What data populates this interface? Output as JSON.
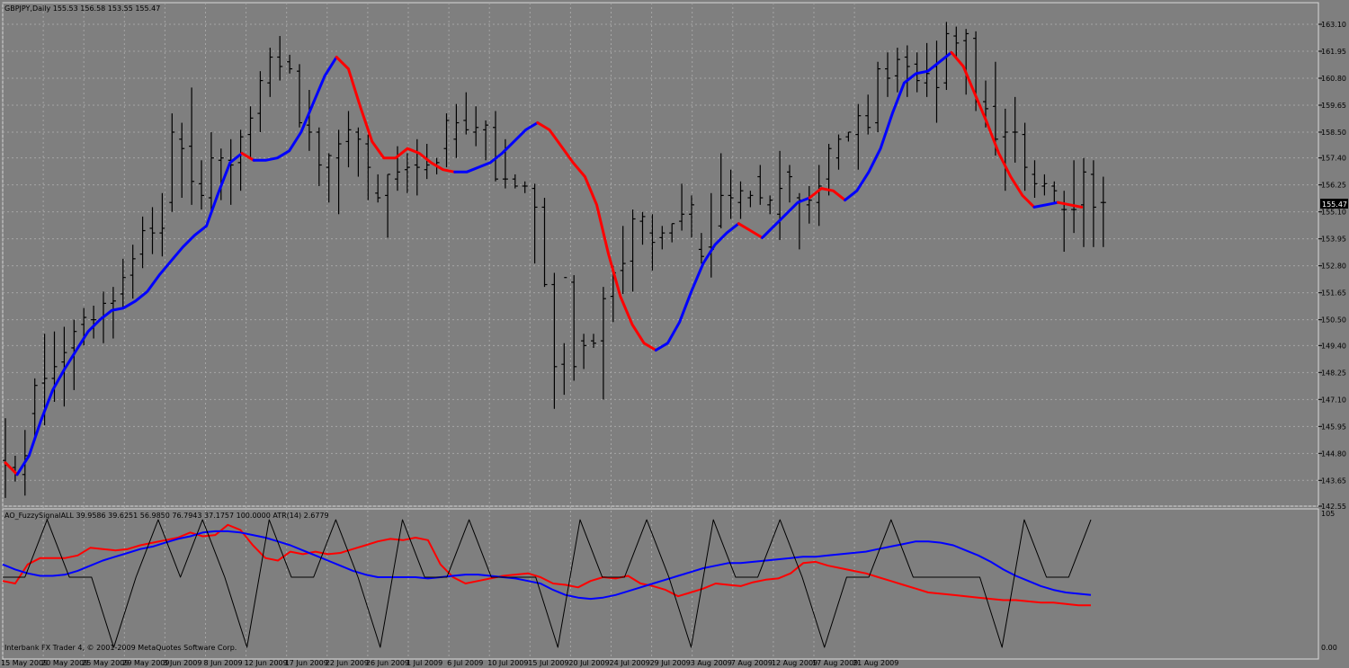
{
  "chart_header": "GBPJPY,Daily  155.53 156.58 153.55 155.47",
  "indicator_header": "AO_FuzzySignalALL 39.9586 39.6251 56.9850 76.7943 37.1757 100.0000  ATR(14) 2.6779",
  "copyright": "Interbank FX Trader 4, © 2001-2009 MetaQuotes Software Corp.",
  "current_price_label": "155.47",
  "colors": {
    "background": "#7f7f7f",
    "bars": "#000000",
    "up": "#0000ff",
    "down": "#ff0000",
    "grid": "#a6a6a6",
    "fuzzy": "#000000"
  },
  "chart_data": [
    {
      "type": "ohlc",
      "ylim": [
        142.55,
        163.1
      ],
      "y_ticks": [
        "163.10",
        "161.95",
        "160.80",
        "159.65",
        "158.50",
        "157.40",
        "156.25",
        "155.10",
        "153.95",
        "152.80",
        "151.65",
        "150.50",
        "149.40",
        "148.25",
        "147.10",
        "145.95",
        "144.80",
        "143.65",
        "142.55"
      ],
      "x_tick_labels": [
        "15 May 2009",
        "20 May 2009",
        "25 May 2009",
        "29 May 2009",
        "3 Jun 2009",
        "8 Jun 2009",
        "12 Jun 2009",
        "17 Jun 2009",
        "22 Jun 2009",
        "26 Jun 2009",
        "1 Jul 2009",
        "6 Jul 2009",
        "10 Jul 2009",
        "15 Jul 2009",
        "20 Jul 2009",
        "24 Jul 2009",
        "29 Jul 2009",
        "3 Aug 2009",
        "7 Aug 2009",
        "12 Aug 2009",
        "17 Aug 2009",
        "21 Aug 2009"
      ],
      "ohlc": [
        [
          144.5,
          146.3,
          142.9,
          144.3
        ],
        [
          144.2,
          144.7,
          143.6,
          143.9
        ],
        [
          143.9,
          145.8,
          143.0,
          144.7
        ],
        [
          146.5,
          148.0,
          145.5,
          147.7
        ],
        [
          147.8,
          149.9,
          146.0,
          148.0
        ],
        [
          148.0,
          150.0,
          147.0,
          148.5
        ],
        [
          148.7,
          150.2,
          146.8,
          149.1
        ],
        [
          149.3,
          150.5,
          147.5,
          150.0
        ],
        [
          150.3,
          151.0,
          149.4,
          150.6
        ],
        [
          150.5,
          151.1,
          149.7,
          150.5
        ],
        [
          150.6,
          151.7,
          149.5,
          151.2
        ],
        [
          151.2,
          151.9,
          149.7,
          151.3
        ],
        [
          151.6,
          153.1,
          151.0,
          152.3
        ],
        [
          152.4,
          153.7,
          151.4,
          153.1
        ],
        [
          153.3,
          154.9,
          152.7,
          154.3
        ],
        [
          154.4,
          155.3,
          153.3,
          154.2
        ],
        [
          154.2,
          155.9,
          153.2,
          154.4
        ],
        [
          155.5,
          159.3,
          155.1,
          158.5
        ],
        [
          158.2,
          158.9,
          155.7,
          157.8
        ],
        [
          157.9,
          160.4,
          155.4,
          156.4
        ],
        [
          156.3,
          157.3,
          155.2,
          155.8
        ],
        [
          155.7,
          158.5,
          155.0,
          157.4
        ],
        [
          157.3,
          157.8,
          155.6,
          157.4
        ],
        [
          157.3,
          158.2,
          155.4,
          157.1
        ],
        [
          157.2,
          158.6,
          156.0,
          158.3
        ],
        [
          158.4,
          159.6,
          157.4,
          159.1
        ],
        [
          159.3,
          161.1,
          158.5,
          160.7
        ],
        [
          160.6,
          162.1,
          160.0,
          161.7
        ],
        [
          161.7,
          162.6,
          160.7,
          161.3
        ],
        [
          161.5,
          161.8,
          161.0,
          161.2
        ],
        [
          161.1,
          161.4,
          158.7,
          158.9
        ],
        [
          158.8,
          160.3,
          157.7,
          158.5
        ],
        [
          158.5,
          158.7,
          156.2,
          157.1
        ],
        [
          157.0,
          157.6,
          155.5,
          157.5
        ],
        [
          157.4,
          158.6,
          155.0,
          158.0
        ],
        [
          158.1,
          159.4,
          157.0,
          158.6
        ],
        [
          158.5,
          158.7,
          156.6,
          158.2
        ],
        [
          158.0,
          158.4,
          155.6,
          157.0
        ],
        [
          155.9,
          156.7,
          155.5,
          155.7
        ],
        [
          155.8,
          156.7,
          154.0,
          156.7
        ],
        [
          156.5,
          157.9,
          156.0,
          156.8
        ],
        [
          156.9,
          157.6,
          155.9,
          157.0
        ],
        [
          157.1,
          158.2,
          155.8,
          157.0
        ],
        [
          156.9,
          158.0,
          156.5,
          157.1
        ],
        [
          157.1,
          157.4,
          156.7,
          157.2
        ],
        [
          157.8,
          159.3,
          157.0,
          159.0
        ],
        [
          158.2,
          159.7,
          157.4,
          158.9
        ],
        [
          159.0,
          160.2,
          158.4,
          158.6
        ],
        [
          158.5,
          159.6,
          157.9,
          158.7
        ],
        [
          158.6,
          159.0,
          157.3,
          158.8
        ],
        [
          158.7,
          159.4,
          156.4,
          156.5
        ],
        [
          156.5,
          158.2,
          156.1,
          156.5
        ],
        [
          156.5,
          156.7,
          156.1,
          156.2
        ],
        [
          156.2,
          156.4,
          155.9,
          156.2
        ],
        [
          156.1,
          156.3,
          152.9,
          155.3
        ],
        [
          155.3,
          155.7,
          151.9,
          152.0
        ],
        [
          152.0,
          152.5,
          146.7,
          148.5
        ],
        [
          148.6,
          149.5,
          147.3,
          152.3
        ],
        [
          152.1,
          152.4,
          147.9,
          148.5
        ],
        [
          149.6,
          149.9,
          148.4,
          149.4
        ],
        [
          149.6,
          149.9,
          149.3,
          149.5
        ],
        [
          149.6,
          151.9,
          147.1,
          151.4
        ],
        [
          151.5,
          152.8,
          150.4,
          152.5
        ],
        [
          152.6,
          154.5,
          151.6,
          152.9
        ],
        [
          153.0,
          155.2,
          151.7,
          154.8
        ],
        [
          154.7,
          155.1,
          153.7,
          154.9
        ],
        [
          154.2,
          155.0,
          152.6,
          153.8
        ],
        [
          154.0,
          154.5,
          153.5,
          154.2
        ],
        [
          154.2,
          154.6,
          153.8,
          154.6
        ],
        [
          154.7,
          156.3,
          154.3,
          155.0
        ],
        [
          155.0,
          155.8,
          154.0,
          155.4
        ],
        [
          153.5,
          154.2,
          152.9,
          153.2
        ],
        [
          153.6,
          155.9,
          152.3,
          153.5
        ],
        [
          154.5,
          157.6,
          154.4,
          155.8
        ],
        [
          155.8,
          156.9,
          154.8,
          155.7
        ],
        [
          155.5,
          156.4,
          154.8,
          156.0
        ],
        [
          155.7,
          156.0,
          155.3,
          155.8
        ],
        [
          156.6,
          157.1,
          155.4,
          155.7
        ],
        [
          155.4,
          155.8,
          155.0,
          155.6
        ],
        [
          155.0,
          157.7,
          153.9,
          156.1
        ],
        [
          156.8,
          157.1,
          155.5,
          156.6
        ],
        [
          155.7,
          155.9,
          153.5,
          155.6
        ],
        [
          155.4,
          156.2,
          154.6,
          155.6
        ],
        [
          155.5,
          157.1,
          154.5,
          156.2
        ],
        [
          156.5,
          158.0,
          155.8,
          157.8
        ],
        [
          157.4,
          158.4,
          156.9,
          158.2
        ],
        [
          158.3,
          158.5,
          158.1,
          158.5
        ],
        [
          158.4,
          159.7,
          156.9,
          159.2
        ],
        [
          159.2,
          160.1,
          158.4,
          158.7
        ],
        [
          158.9,
          161.5,
          158.5,
          161.2
        ],
        [
          161.2,
          161.9,
          160.0,
          160.8
        ],
        [
          160.9,
          162.1,
          160.2,
          161.6
        ],
        [
          161.7,
          162.2,
          160.0,
          161.3
        ],
        [
          161.4,
          161.9,
          160.2,
          160.7
        ],
        [
          160.6,
          162.3,
          160.0,
          161.0
        ],
        [
          161.3,
          162.4,
          158.9,
          160.4
        ],
        [
          160.6,
          163.2,
          160.3,
          162.7
        ],
        [
          162.6,
          163.0,
          161.7,
          162.3
        ],
        [
          162.4,
          162.9,
          160.1,
          162.7
        ],
        [
          162.5,
          162.8,
          159.4,
          159.8
        ],
        [
          159.8,
          160.7,
          158.7,
          159.5
        ],
        [
          159.6,
          161.5,
          157.5,
          158.2
        ],
        [
          158.3,
          159.5,
          156.0,
          158.5
        ],
        [
          158.5,
          160.0,
          157.2,
          158.5
        ],
        [
          158.4,
          158.9,
          156.0,
          157.0
        ],
        [
          156.7,
          157.3,
          155.7,
          156.3
        ],
        [
          156.2,
          156.7,
          155.8,
          156.3
        ],
        [
          156.2,
          156.4,
          155.5,
          156.0
        ],
        [
          155.2,
          156.0,
          153.4,
          155.2
        ],
        [
          155.2,
          157.3,
          154.2,
          155.2
        ],
        [
          155.4,
          157.4,
          153.6,
          156.8
        ],
        [
          156.7,
          157.3,
          153.6,
          155.3
        ],
        [
          155.5,
          156.6,
          153.6,
          155.5
        ]
      ],
      "smoothed_line": [
        {
          "start": 0,
          "color": "red",
          "values": [
            144.4,
            143.9
          ]
        },
        {
          "start": 1,
          "color": "blue",
          "values": [
            143.9,
            144.7,
            146.2,
            147.5,
            148.4,
            149.2,
            150.0,
            150.5,
            150.9,
            151.0,
            151.3,
            151.7,
            152.4,
            153.0,
            153.6,
            154.1,
            154.5,
            155.9,
            157.2,
            157.6
          ]
        },
        {
          "start": 20,
          "color": "red",
          "values": [
            157.6,
            157.3
          ]
        },
        {
          "start": 21,
          "color": "blue",
          "values": [
            157.3,
            157.3,
            157.4,
            157.7,
            158.5,
            159.7,
            160.9,
            161.7
          ]
        },
        {
          "start": 28,
          "color": "red",
          "values": [
            161.7,
            161.2,
            159.6,
            158.1,
            157.4,
            157.4,
            157.8,
            157.6,
            157.2,
            156.9,
            156.8
          ]
        },
        {
          "start": 38,
          "color": "blue",
          "values": [
            156.8,
            156.8,
            157.0,
            157.2,
            157.6,
            158.1,
            158.6,
            158.9
          ]
        },
        {
          "start": 45,
          "color": "red",
          "values": [
            158.9,
            158.6,
            157.9,
            157.2,
            156.6,
            155.4,
            153.3,
            151.5,
            150.3,
            149.5,
            149.2
          ]
        },
        {
          "start": 55,
          "color": "blue",
          "values": [
            149.2,
            149.5,
            150.4,
            151.7,
            152.9,
            153.7,
            154.2,
            154.6
          ]
        },
        {
          "start": 62,
          "color": "red",
          "values": [
            154.6,
            154.3,
            154.0
          ]
        },
        {
          "start": 64,
          "color": "blue",
          "values": [
            154.0,
            154.5,
            155.0,
            155.5,
            155.7
          ]
        },
        {
          "start": 68,
          "color": "red",
          "values": [
            155.7,
            156.1,
            156.0,
            155.6
          ]
        },
        {
          "start": 71,
          "color": "blue",
          "values": [
            155.6,
            156.0,
            156.8,
            157.8,
            159.3,
            160.6,
            161.0,
            161.1,
            161.5,
            161.9
          ]
        },
        {
          "start": 80,
          "color": "red",
          "values": [
            161.9,
            161.3,
            160.1,
            158.9,
            157.6,
            156.6,
            155.8,
            155.3
          ]
        },
        {
          "start": 87,
          "color": "blue",
          "values": [
            155.3,
            155.4,
            155.5
          ]
        },
        {
          "start": 89,
          "color": "red",
          "values": [
            155.5,
            155.4,
            155.3
          ]
        }
      ]
    },
    {
      "type": "line",
      "ylim": [
        0,
        105
      ],
      "y_ticks": [
        "105",
        "0.00"
      ],
      "series": [
        {
          "color": "red",
          "values": [
            52,
            50,
            65,
            70,
            70,
            70,
            72,
            78,
            77,
            76,
            77,
            80,
            82,
            84,
            86,
            90,
            87,
            88,
            96,
            92,
            80,
            70,
            68,
            75,
            73,
            75,
            73,
            74,
            77,
            80,
            83,
            85,
            84,
            86,
            84,
            65,
            55,
            50,
            52,
            54,
            56,
            57,
            58,
            55,
            50,
            49,
            47,
            52,
            55,
            54,
            56,
            50,
            48,
            45,
            40,
            43,
            46,
            50,
            49,
            48,
            51,
            53,
            54,
            58,
            66,
            67,
            64,
            62,
            60,
            58,
            55,
            52,
            49,
            46,
            43,
            42,
            41,
            40,
            39,
            38,
            37,
            37,
            36,
            35,
            35,
            34,
            33,
            33
          ]
        },
        {
          "color": "blue",
          "values": [
            65,
            61,
            58,
            56,
            56,
            57,
            60,
            64,
            68,
            71,
            74,
            77,
            79,
            82,
            85,
            87,
            90,
            91,
            91,
            90,
            88,
            86,
            83,
            80,
            76,
            72,
            68,
            64,
            60,
            57,
            55,
            55,
            55,
            55,
            54,
            55,
            56,
            57,
            57,
            56,
            55,
            54,
            52,
            50,
            45,
            41,
            39,
            38,
            39,
            41,
            44,
            47,
            50,
            53,
            56,
            59,
            62,
            64,
            66,
            66,
            67,
            68,
            69,
            70,
            71,
            71,
            72,
            73,
            74,
            75,
            77,
            79,
            81,
            83,
            83,
            82,
            80,
            76,
            72,
            67,
            61,
            56,
            52,
            48,
            45,
            43,
            42,
            41
          ]
        },
        {
          "color": "black",
          "values": [
            55,
            55,
            100,
            55,
            55,
            0,
            55,
            100,
            55,
            100,
            55,
            0,
            100,
            55,
            55,
            100,
            55,
            0,
            100,
            55,
            55,
            100,
            55,
            55,
            55,
            0,
            100,
            55,
            55,
            100,
            55,
            0,
            100,
            55,
            55,
            100,
            55,
            0,
            55,
            55,
            100,
            55,
            55,
            55,
            55,
            0,
            100,
            55,
            55,
            100
          ]
        }
      ]
    }
  ]
}
